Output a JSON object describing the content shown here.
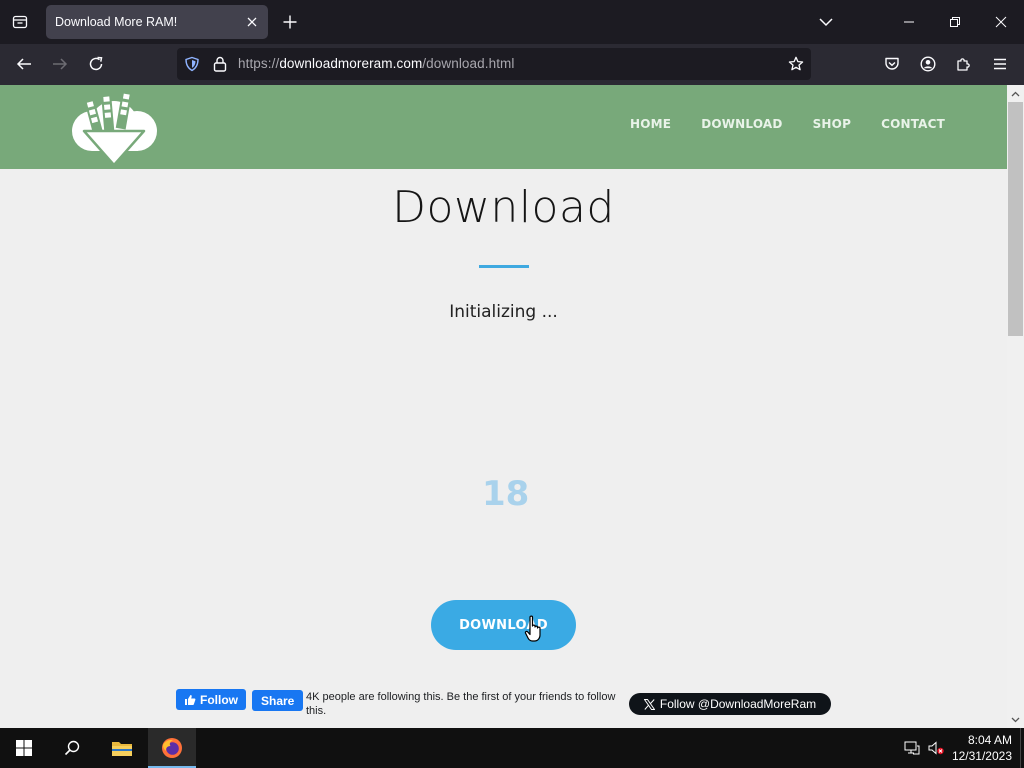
{
  "browser": {
    "tab": {
      "title": "Download More RAM!"
    },
    "url": {
      "scheme": "https://",
      "host": "downloadmoreram.com",
      "path": "/download.html"
    }
  },
  "site": {
    "nav": [
      "HOME",
      "DOWNLOAD",
      "SHOP",
      "CONTACT"
    ],
    "title": "Download",
    "status": "Initializing ...",
    "progress": {
      "value": 18,
      "display": "18"
    },
    "download_button": "DOWNLOAD",
    "social": {
      "fb_follow": "Follow",
      "fb_share": "Share",
      "fb_text": "4K people are following this. Be the first of your friends to follow this.",
      "twitter_follow": "Follow @DownloadMoreRam"
    },
    "colors": {
      "header": "#78a97a",
      "accent": "#3aaae4",
      "progress": "#a9d2ec"
    }
  },
  "taskbar": {
    "time": "8:04 AM",
    "date": "12/31/2023"
  }
}
